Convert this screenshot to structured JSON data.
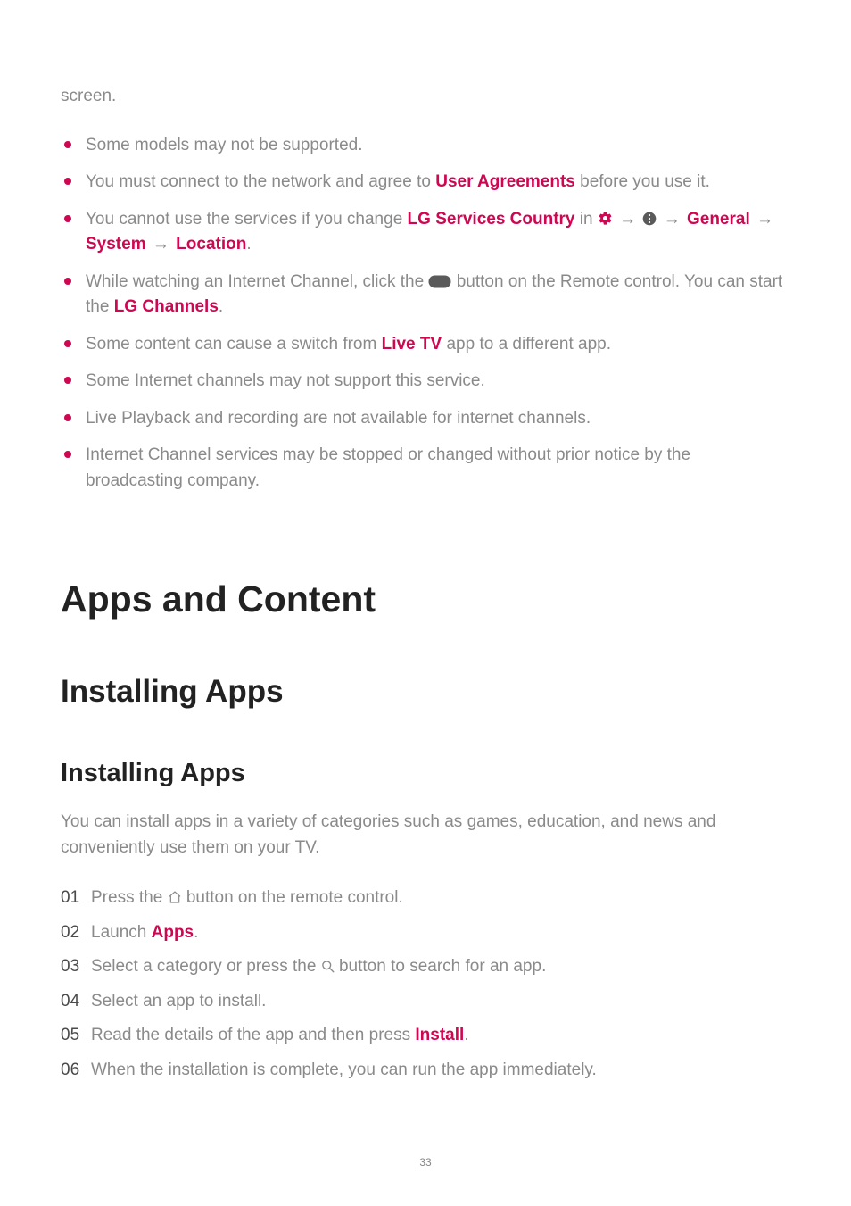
{
  "lead": "screen.",
  "bullets": {
    "b1": "Some models may not be supported.",
    "b2_a": "You must connect to the network and agree to ",
    "b2_hl": "User Agreements",
    "b2_b": " before you use it.",
    "b3_a": "You cannot use the services if you change ",
    "b3_hl1": "LG Services Country",
    "b3_in": " in ",
    "b3_hl2": "General",
    "b3_hl3": "System",
    "b3_hl4": "Location",
    "b3_dot": ".",
    "b4_a": "While watching an Internet Channel, click the ",
    "b4_b": " button on the Remote control. You can start the ",
    "b4_hl": "LG Channels",
    "b4_c": ".",
    "b5_a": "Some content can cause a switch from ",
    "b5_hl": "Live TV",
    "b5_b": " app to a different app.",
    "b6": "Some Internet channels may not support this service.",
    "b7": "Live Playback and recording are not available for internet channels.",
    "b8": "Internet Channel services may be stopped or changed without prior notice by the broadcasting company."
  },
  "h1": "Apps and Content",
  "h2": "Installing Apps",
  "h3": "Installing Apps",
  "desc": "You can install apps in a variety of categories such as games, education, and news and conveniently use them on your TV.",
  "steps": {
    "n1": "01",
    "s1_a": "Press the ",
    "s1_b": " button on the remote control.",
    "n2": "02",
    "s2_a": "Launch ",
    "s2_hl": "Apps",
    "s2_b": ".",
    "n3": "03",
    "s3_a": "Select a category or press the ",
    "s3_b": " button to search for an app.",
    "n4": "04",
    "s4": "Select an app to install.",
    "n5": "05",
    "s5_a": "Read the details of the app and then press ",
    "s5_hl": "Install",
    "s5_b": ".",
    "n6": "06",
    "s6": "When the installation is complete, you can run the app immediately."
  },
  "arrow": "→",
  "page_number": "33"
}
